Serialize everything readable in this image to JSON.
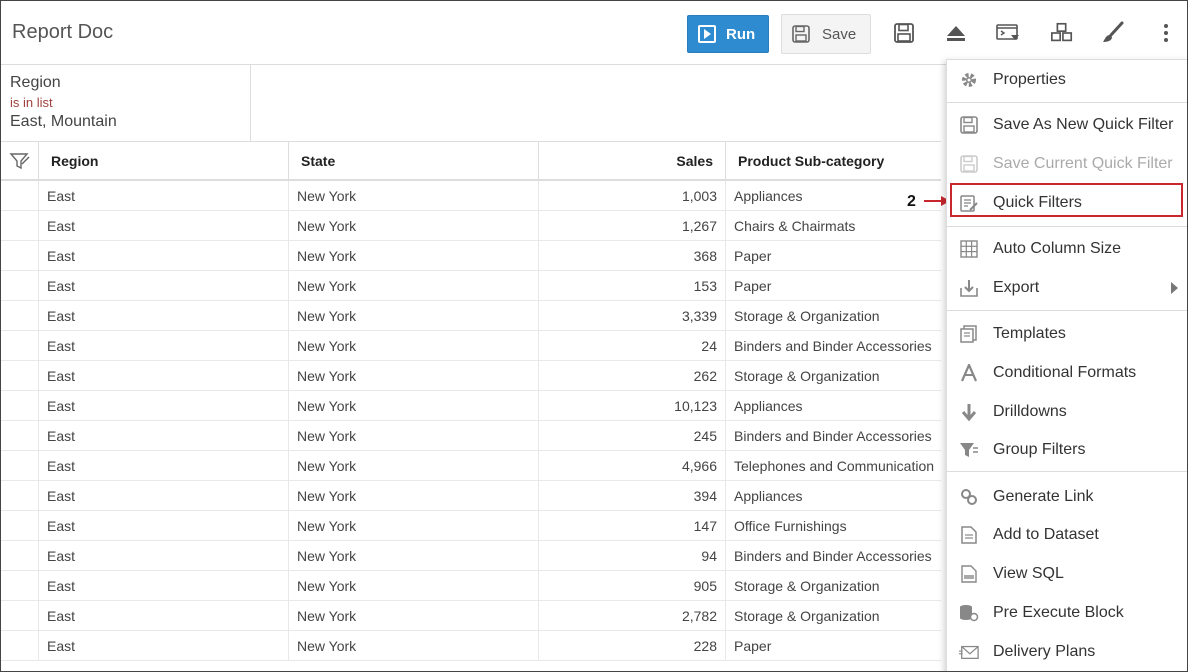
{
  "header": {
    "title": "Report Doc",
    "run_label": "Run",
    "save_label": "Save"
  },
  "filter": {
    "field": "Region",
    "operator": "is in list",
    "value": "East, Mountain"
  },
  "table": {
    "columns": [
      "Region",
      "State",
      "Sales",
      "Product Sub-category"
    ],
    "rows": [
      [
        "East",
        "New York",
        "1,003",
        "Appliances"
      ],
      [
        "East",
        "New York",
        "1,267",
        "Chairs & Chairmats"
      ],
      [
        "East",
        "New York",
        "368",
        "Paper"
      ],
      [
        "East",
        "New York",
        "153",
        "Paper"
      ],
      [
        "East",
        "New York",
        "3,339",
        "Storage & Organization"
      ],
      [
        "East",
        "New York",
        "24",
        "Binders and Binder Accessories"
      ],
      [
        "East",
        "New York",
        "262",
        "Storage & Organization"
      ],
      [
        "East",
        "New York",
        "10,123",
        "Appliances"
      ],
      [
        "East",
        "New York",
        "245",
        "Binders and Binder Accessories"
      ],
      [
        "East",
        "New York",
        "4,966",
        "Telephones and Communication"
      ],
      [
        "East",
        "New York",
        "394",
        "Appliances"
      ],
      [
        "East",
        "New York",
        "147",
        "Office Furnishings"
      ],
      [
        "East",
        "New York",
        "94",
        "Binders and Binder Accessories"
      ],
      [
        "East",
        "New York",
        "905",
        "Storage & Organization"
      ],
      [
        "East",
        "New York",
        "2,782",
        "Storage & Organization"
      ],
      [
        "East",
        "New York",
        "228",
        "Paper"
      ]
    ]
  },
  "menu": {
    "items": [
      {
        "label": "Properties",
        "icon": "gear-icon"
      },
      {
        "label": "Save As New Quick Filter",
        "icon": "save-icon"
      },
      {
        "label": "Save Current Quick Filter",
        "icon": "save-icon",
        "disabled": true
      },
      {
        "label": "Quick Filters",
        "icon": "quick-filter-icon",
        "highlighted": true
      },
      {
        "label": "Auto Column Size",
        "icon": "grid-icon"
      },
      {
        "label": "Export",
        "icon": "download-icon",
        "has_submenu": true
      },
      {
        "label": "Templates",
        "icon": "template-icon"
      },
      {
        "label": "Conditional Formats",
        "icon": "letter-a-icon"
      },
      {
        "label": "Drilldowns",
        "icon": "arrow-down-icon"
      },
      {
        "label": "Group Filters",
        "icon": "funnel-icon"
      },
      {
        "label": "Generate Link",
        "icon": "link-icon"
      },
      {
        "label": "Add to Dataset",
        "icon": "document-icon"
      },
      {
        "label": "View SQL",
        "icon": "sql-file-icon"
      },
      {
        "label": "Pre Execute Block",
        "icon": "database-gear-icon"
      },
      {
        "label": "Delivery Plans",
        "icon": "envelope-icon"
      }
    ]
  },
  "annotation": {
    "step_number": "2",
    "color": "#c8272d"
  },
  "colors": {
    "run_button": "#2f8bd0",
    "filter_operator": "#a0423f"
  }
}
